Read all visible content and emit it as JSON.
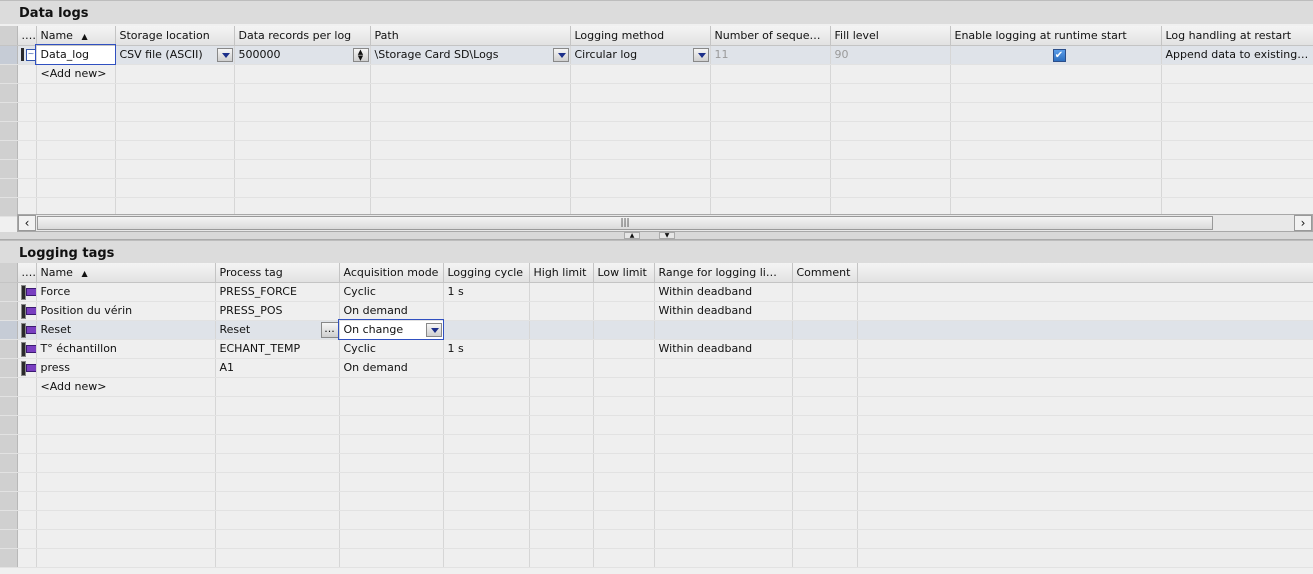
{
  "data_logs": {
    "title": "Data logs",
    "columns": [
      "...",
      "Name",
      "Storage location",
      "Data records per log",
      "Path",
      "Logging method",
      "Number of sequen...",
      "Fill level",
      "Enable logging at runtime start",
      "Log handling at restart"
    ],
    "rows": [
      {
        "name": "Data_log",
        "storage": "CSV file (ASCII)",
        "records": "500000",
        "path": "\\Storage Card SD\\Logs",
        "method": "Circular log",
        "seq": "11",
        "fill": "90",
        "enable": true,
        "restart": "Append data to existing l..."
      }
    ],
    "add_new": "<Add new>"
  },
  "logging_tags": {
    "title": "Logging tags",
    "columns": [
      "...",
      "Name",
      "Process tag",
      "Acquisition mode",
      "Logging cycle",
      "High limit",
      "Low limit",
      "Range for logging limits",
      "Comment"
    ],
    "rows": [
      {
        "name": "Force",
        "tag": "PRESS_FORCE",
        "mode": "Cyclic",
        "cycle": "1 s",
        "range": "Within deadband"
      },
      {
        "name": "Position du vérin",
        "tag": "PRESS_POS",
        "mode": "On demand",
        "cycle": "",
        "range": "Within deadband"
      },
      {
        "name": "Reset",
        "tag": "Reset",
        "mode": "On change",
        "cycle": "",
        "range": ""
      },
      {
        "name": "T° échantillon",
        "tag": "ECHANT_TEMP",
        "mode": "Cyclic",
        "cycle": "1 s",
        "range": "Within deadband"
      },
      {
        "name": "press",
        "tag": "A1",
        "mode": "On demand",
        "cycle": "",
        "range": ""
      }
    ],
    "add_new": "<Add new>"
  },
  "scrollbar_grip": "|||"
}
